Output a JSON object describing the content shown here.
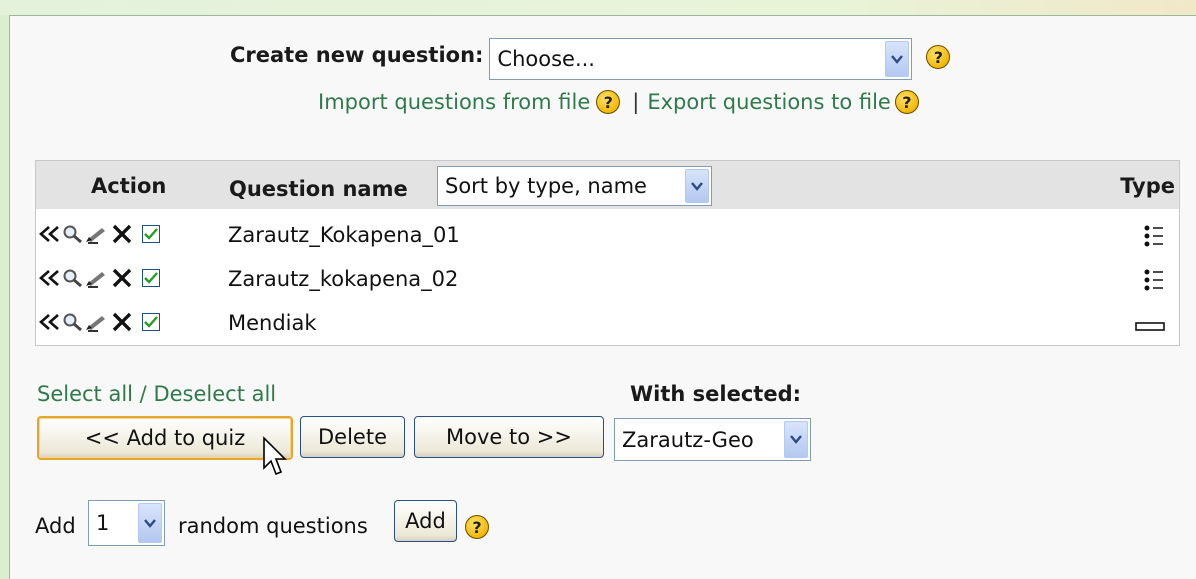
{
  "create": {
    "label": "Create new question:",
    "select_value": "Choose...",
    "help": "?"
  },
  "links": {
    "import": "Import questions from file",
    "separator": "|",
    "export": "Export questions to file",
    "help": "?"
  },
  "table": {
    "header_action": "Action",
    "header_name": "Question name",
    "sort_value": "Sort by type, name",
    "header_type": "Type",
    "rows": [
      {
        "name": "Zarautz_Kokapena_01",
        "checked": true,
        "type_icon": "multichoice-icon"
      },
      {
        "name": "Zarautz_kokapena_02",
        "checked": true,
        "type_icon": "multichoice-icon"
      },
      {
        "name": "Mendiak",
        "checked": true,
        "type_icon": "shortanswer-icon"
      }
    ]
  },
  "selection": {
    "select_all": "Select all",
    "slash": " / ",
    "deselect_all": "Deselect all",
    "with_selected": "With selected:"
  },
  "buttons": {
    "add_to_quiz": "<< Add to quiz",
    "delete": "Delete",
    "move_to": "Move to >>",
    "category_value": "Zarautz-Geo"
  },
  "random": {
    "prefix": "Add",
    "count_value": "1",
    "suffix": "random questions",
    "add_button": "Add",
    "help": "?"
  },
  "colors": {
    "link": "#2f7a4a",
    "header_bg": "#e3e3e3",
    "page_bg": "#d8f0d0"
  }
}
